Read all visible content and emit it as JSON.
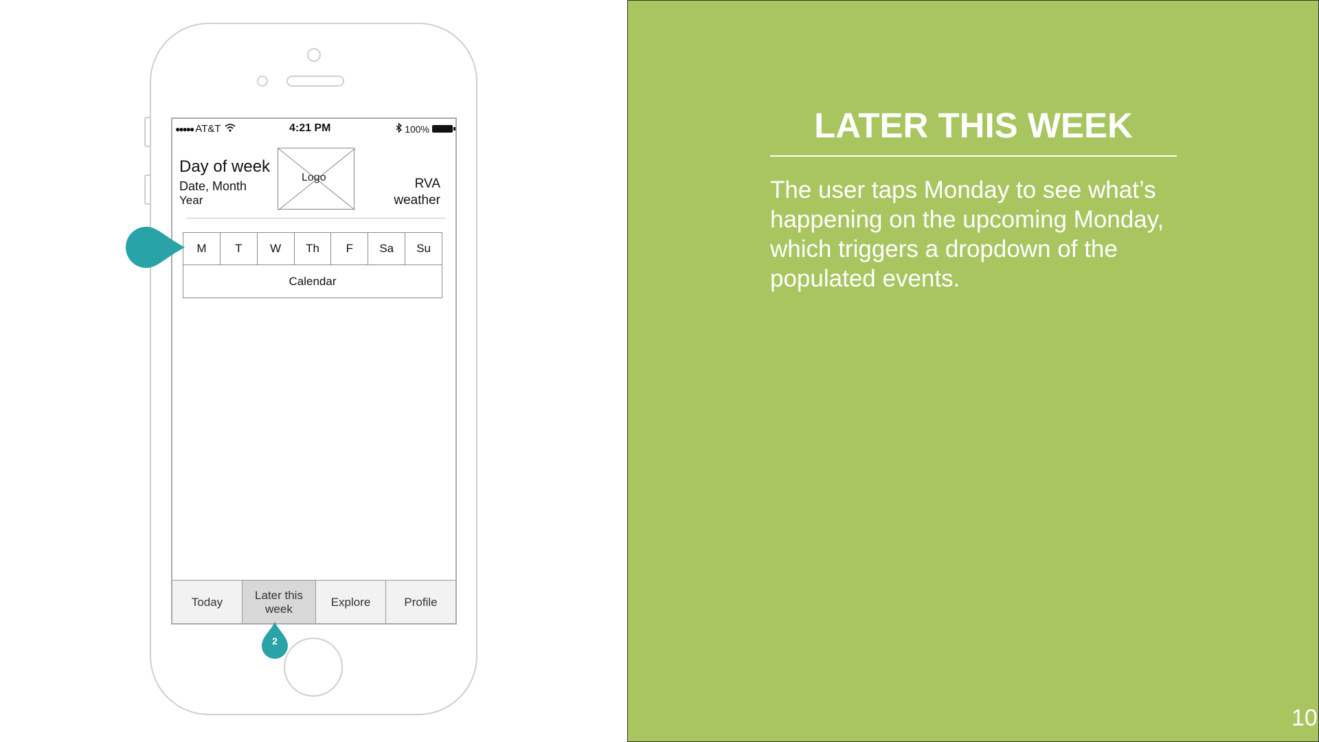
{
  "status_bar": {
    "carrier": "AT&T",
    "time": "4:21 PM",
    "battery": "100%"
  },
  "header": {
    "day_of_week": "Day of week",
    "date_month": "Date, Month",
    "year": "Year",
    "logo": "Logo",
    "weather_line1": "RVA",
    "weather_line2": "weather"
  },
  "week_days": [
    "M",
    "T",
    "W",
    "Th",
    "F",
    "Sa",
    "Su"
  ],
  "calendar_label": "Calendar",
  "tabs": [
    {
      "label": "Today",
      "active": false
    },
    {
      "label": "Later this week",
      "active": true
    },
    {
      "label": "Explore",
      "active": false
    },
    {
      "label": "Profile",
      "active": false
    }
  ],
  "markers": {
    "step_number": "2",
    "color": "#29a3a8"
  },
  "panel": {
    "title": "LATER THIS WEEK",
    "body": "The user taps Monday to see what’s happening on the upcoming Monday, which triggers a dropdown of the populated events.",
    "page_number": "10",
    "background": "#a8c560"
  }
}
